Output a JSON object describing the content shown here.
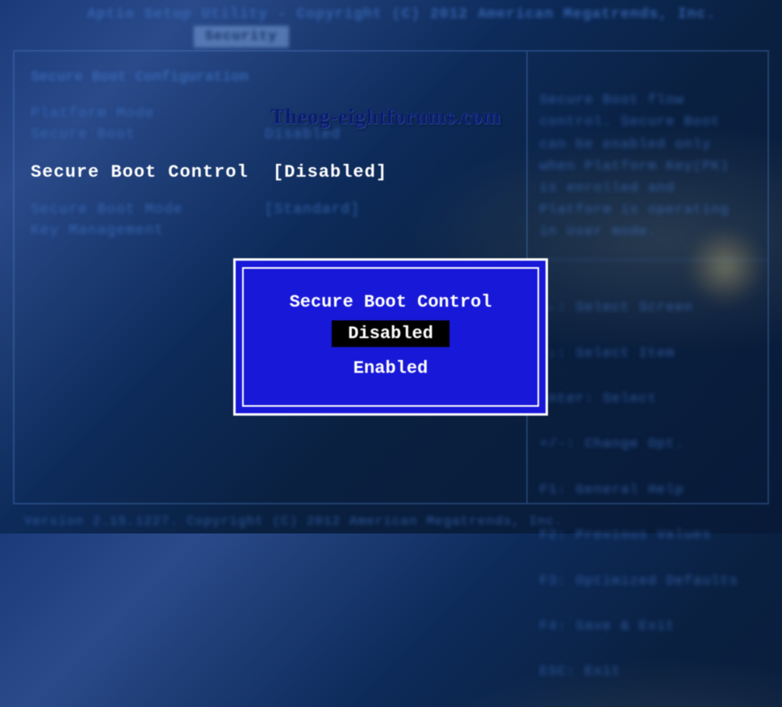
{
  "header": {
    "title": "Aptio Setup Utility - Copyright (C) 2012 American Megatrends, Inc."
  },
  "tabs": {
    "active": "Security"
  },
  "left": {
    "section_title": "Secure Boot Configuration",
    "rows": [
      {
        "label": "Platform Mode",
        "value": ""
      },
      {
        "label": "Secure Boot",
        "value": "Disabled"
      }
    ],
    "selected": {
      "label": "Secure Boot Control",
      "value": "[Disabled]"
    },
    "rows2": [
      {
        "label": "Secure Boot Mode",
        "value": "[Standard]"
      },
      {
        "label": "Key Management",
        "value": ""
      }
    ]
  },
  "right": {
    "help_text": "Secure Boot flow control. Secure Boot can be enabled only when Platform Key(PK) is enrolled and Platform is operating in User mode.",
    "keys": [
      "→←: Select Screen",
      "↑↓: Select Item",
      "Enter: Select",
      "+/-: Change Opt.",
      "F1: General Help",
      "F2: Previous Values",
      "F3: Optimized Defaults",
      "F4: Save & Exit",
      "ESC: Exit"
    ]
  },
  "popup": {
    "title": "Secure Boot Control",
    "options": [
      "Disabled",
      "Enabled"
    ],
    "selected_index": 0
  },
  "footer": {
    "version": "Version 2.15.1227. Copyright (C) 2012 American Megatrends, Inc."
  },
  "watermark": "Theog-eightforums.com"
}
